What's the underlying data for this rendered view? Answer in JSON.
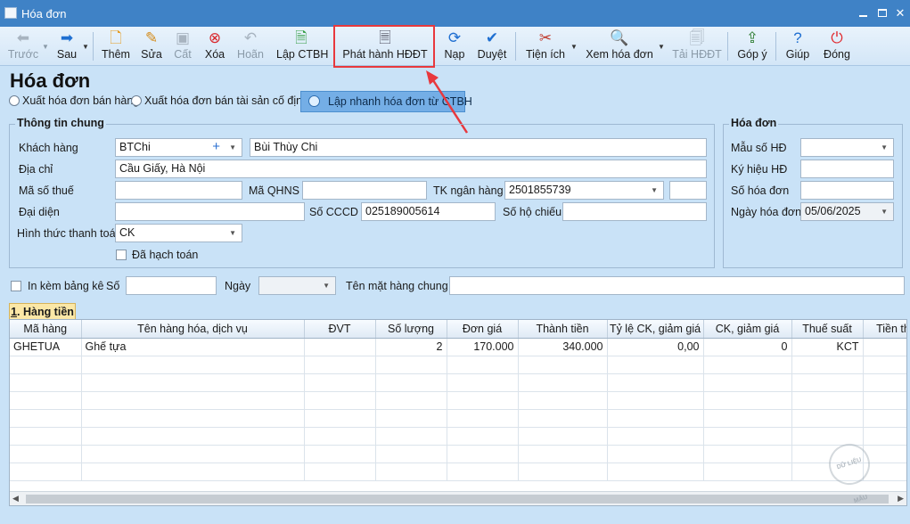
{
  "window": {
    "title": "Hóa đơn"
  },
  "toolbar": {
    "prev": "Trước",
    "next": "Sau",
    "add": "Thêm",
    "edit": "Sửa",
    "save": "Cất",
    "delete": "Xóa",
    "undo": "Hoãn",
    "create_ctbh": "Lập CTBH",
    "issue_einvoice": "Phát hành HĐĐT",
    "reload": "Nạp",
    "approve": "Duyệt",
    "utilities": "Tiện ích",
    "view_invoice": "Xem hóa đơn",
    "download_einvoice": "Tải HĐĐT",
    "feedback": "Góp ý",
    "help": "Giúp",
    "close": "Đóng"
  },
  "page": {
    "title": "Hóa đơn",
    "radio_sales": "Xuất hóa đơn bán hàng",
    "radio_fixed_asset": "Xuất hóa đơn bán tài sản cố định",
    "quick_button": "Lập nhanh hóa đơn từ CTBH"
  },
  "general": {
    "legend": "Thông tin chung",
    "customer_label": "Khách hàng",
    "customer_code": "BTChi",
    "customer_name": "Bùi Thùy Chi",
    "address_label": "Địa chỉ",
    "address": "Cầu Giấy, Hà Nội",
    "tax_code_label": "Mã số thuế",
    "tax_code": "",
    "qhns_label": "Mã QHNS",
    "qhns": "",
    "bank_account_label": "TK ngân hàng",
    "bank_account": "2501855739",
    "bank_extra": "",
    "representative_label": "Đại diện",
    "representative": "",
    "id_card_label": "Số CCCD",
    "id_card": "025189005614",
    "passport_label": "Số hộ chiếu",
    "passport": "",
    "payment_method_label": "Hình thức thanh toán",
    "payment_method": "CK",
    "posted_label": "Đã hạch toán"
  },
  "invoice": {
    "legend": "Hóa đơn",
    "template_label": "Mẫu số HĐ",
    "template": "",
    "symbol_label": "Ký hiệu HĐ",
    "symbol": "",
    "number_label": "Số hóa đơn",
    "number": "",
    "date_label": "Ngày hóa đơn",
    "date": "05/06/2025"
  },
  "attach": {
    "attach_label": "In kèm bảng kê",
    "number_label": "Số",
    "number": "",
    "date_label": "Ngày",
    "date": "",
    "common_name_label": "Tên mặt hàng chung",
    "common_name": ""
  },
  "tab": {
    "index": "1",
    "label": ". Hàng tiền"
  },
  "grid": {
    "columns": [
      "Mã hàng",
      "Tên hàng hóa, dịch vụ",
      "ĐVT",
      "Số lượng",
      "Đơn giá",
      "Thành tiền",
      "Tỷ lệ CK, giảm giá",
      "CK, giảm giá",
      "Thuế suất",
      "Tiền th"
    ],
    "rows": [
      [
        "GHETUA",
        "Ghế tựa",
        "",
        "2",
        "170.000",
        "340.000",
        "0,00",
        "0",
        "KCT",
        ""
      ]
    ]
  },
  "watermark": "DỮ LIỆU MẪU"
}
